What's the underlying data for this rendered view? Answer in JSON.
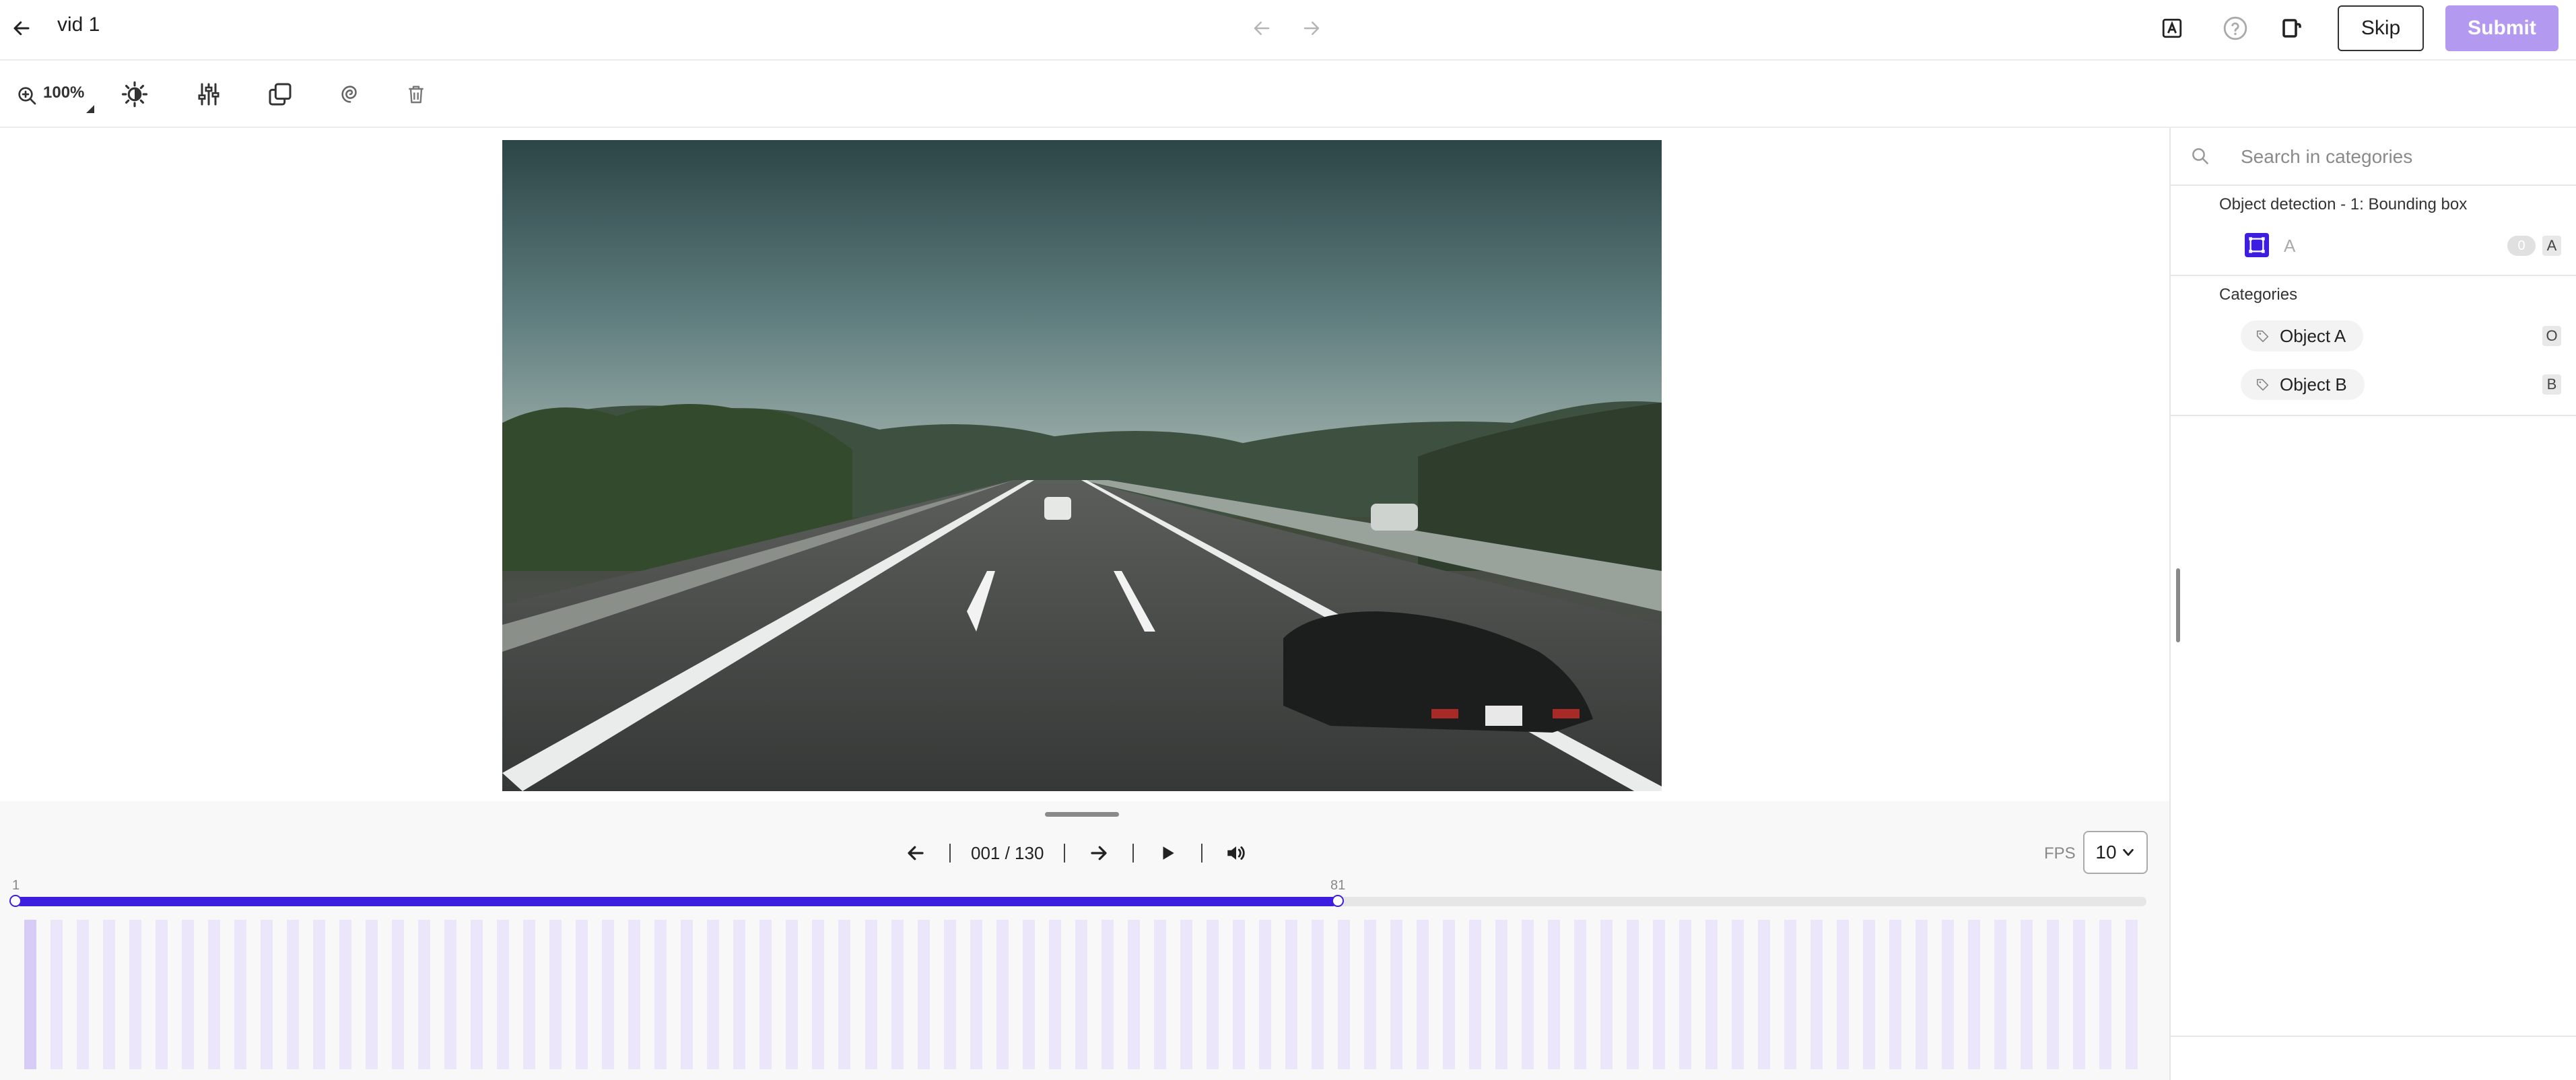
{
  "header": {
    "title": "vid 1",
    "skip_label": "Skip",
    "submit_label": "Submit"
  },
  "toolbar": {
    "zoom_label": "100%"
  },
  "player": {
    "frame_counter": "001 / 130",
    "fps_label": "FPS",
    "fps_value": "10",
    "range_start": "1",
    "range_end": "81",
    "progress": 0.62,
    "frame_count": 81
  },
  "sidebar": {
    "search_placeholder": "Search in categories",
    "task_title": "Object detection - 1: Bounding box",
    "task_item": {
      "label": "A",
      "count": "0",
      "hotkey": "A"
    },
    "categories_title": "Categories",
    "categories": [
      {
        "label": "Object A",
        "hotkey": "O"
      },
      {
        "label": "Object B",
        "hotkey": "B"
      }
    ]
  },
  "colors": {
    "accent": "#3d1ee0",
    "submit": "#b399f0",
    "frame_bar": "#ece6fb"
  }
}
